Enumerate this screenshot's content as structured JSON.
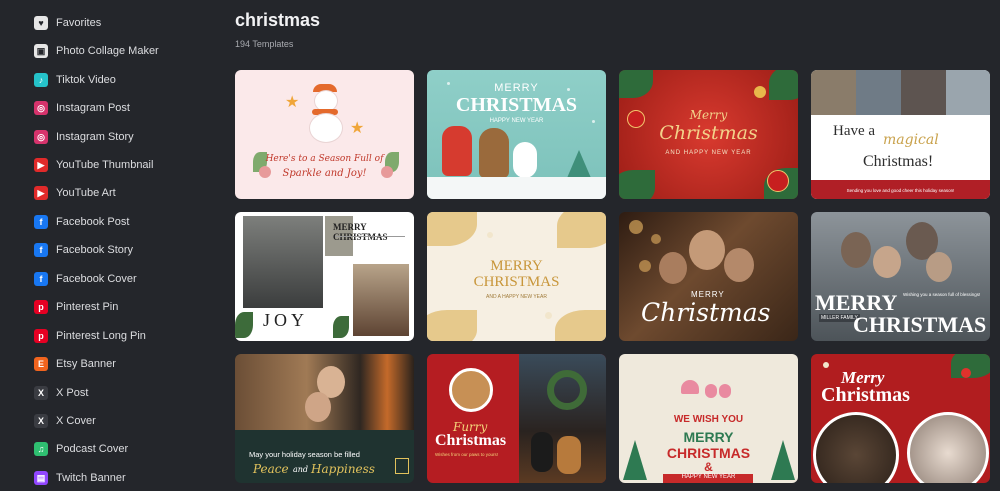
{
  "sidebar": {
    "items": [
      {
        "label": "Favorites",
        "icon": "heart-icon",
        "color": "#e6e6e6",
        "glyph": "♥"
      },
      {
        "label": "Photo Collage Maker",
        "icon": "collage-icon",
        "color": "#e6e6e6",
        "glyph": "▣"
      },
      {
        "label": "Tiktok Video",
        "icon": "tiktok-icon",
        "color": "#25c2c9",
        "glyph": "♪"
      },
      {
        "label": "Instagram Post",
        "icon": "instagram-icon",
        "color": "#d6336c",
        "glyph": "◎"
      },
      {
        "label": "Instagram Story",
        "icon": "instagram-icon",
        "color": "#d6336c",
        "glyph": "◎"
      },
      {
        "label": "YouTube Thumbnail",
        "icon": "youtube-icon",
        "color": "#e02a2a",
        "glyph": "▶"
      },
      {
        "label": "YouTube Art",
        "icon": "youtube-icon",
        "color": "#e02a2a",
        "glyph": "▶"
      },
      {
        "label": "Facebook Post",
        "icon": "facebook-icon",
        "color": "#1877f2",
        "glyph": "f"
      },
      {
        "label": "Facebook Story",
        "icon": "facebook-icon",
        "color": "#1877f2",
        "glyph": "f"
      },
      {
        "label": "Facebook Cover",
        "icon": "facebook-icon",
        "color": "#1877f2",
        "glyph": "f"
      },
      {
        "label": "Pinterest Pin",
        "icon": "pinterest-icon",
        "color": "#e60023",
        "glyph": "p"
      },
      {
        "label": "Pinterest Long Pin",
        "icon": "pinterest-icon",
        "color": "#e60023",
        "glyph": "p"
      },
      {
        "label": "Etsy Banner",
        "icon": "etsy-icon",
        "color": "#f1641e",
        "glyph": "E"
      },
      {
        "label": "X Post",
        "icon": "x-icon",
        "color": "#3a3c42",
        "glyph": "X"
      },
      {
        "label": "X Cover",
        "icon": "x-icon",
        "color": "#3a3c42",
        "glyph": "X"
      },
      {
        "label": "Podcast Cover",
        "icon": "podcast-icon",
        "color": "#2fbf71",
        "glyph": "♫"
      },
      {
        "label": "Twitch Banner",
        "icon": "twitch-icon",
        "color": "#9146ff",
        "glyph": "▤"
      }
    ]
  },
  "main": {
    "title": "christmas",
    "count": "194 Templates"
  },
  "cards": [
    {
      "line1": "Here's to a Season Full of",
      "line2": "Sparkle and Joy!"
    },
    {
      "line1": "MERRY",
      "line2": "CHRISTMAS",
      "line3": "HAPPY NEW YEAR"
    },
    {
      "line1": "Merry",
      "line2": "Christmas",
      "line3": "AND HAPPY NEW YEAR"
    },
    {
      "line1": "Have a",
      "line2": "magical",
      "line3": "Christmas!",
      "line4": "Sending you love and good cheer this holiday season!"
    },
    {
      "line1": "MERRY CHRISTMAS",
      "line2": "JOY"
    },
    {
      "line1": "MERRY",
      "line2": "CHRISTMAS",
      "line3": "AND A HAPPY NEW YEAR"
    },
    {
      "line1": "MERRY",
      "line2": "Christmas"
    },
    {
      "line1": "MERRY",
      "line2": "CHRISTMAS",
      "line3": "Wishing you a season full of blessings!",
      "line4": "MILLER FAMILY"
    },
    {
      "line1": "May your holiday season be filled",
      "line2": "Peace",
      "line3": "and",
      "line4": "Happiness"
    },
    {
      "line1": "Furry",
      "line2": "Christmas",
      "line3": "Wishes from our paws to yours!"
    },
    {
      "line1": "WE WISH YOU",
      "line2": "MERRY",
      "line3": "CHRISTMAS",
      "line4": "&",
      "line5": "HAPPY NEW YEAR"
    },
    {
      "line1": "Merry",
      "line2": "Christmas"
    }
  ]
}
